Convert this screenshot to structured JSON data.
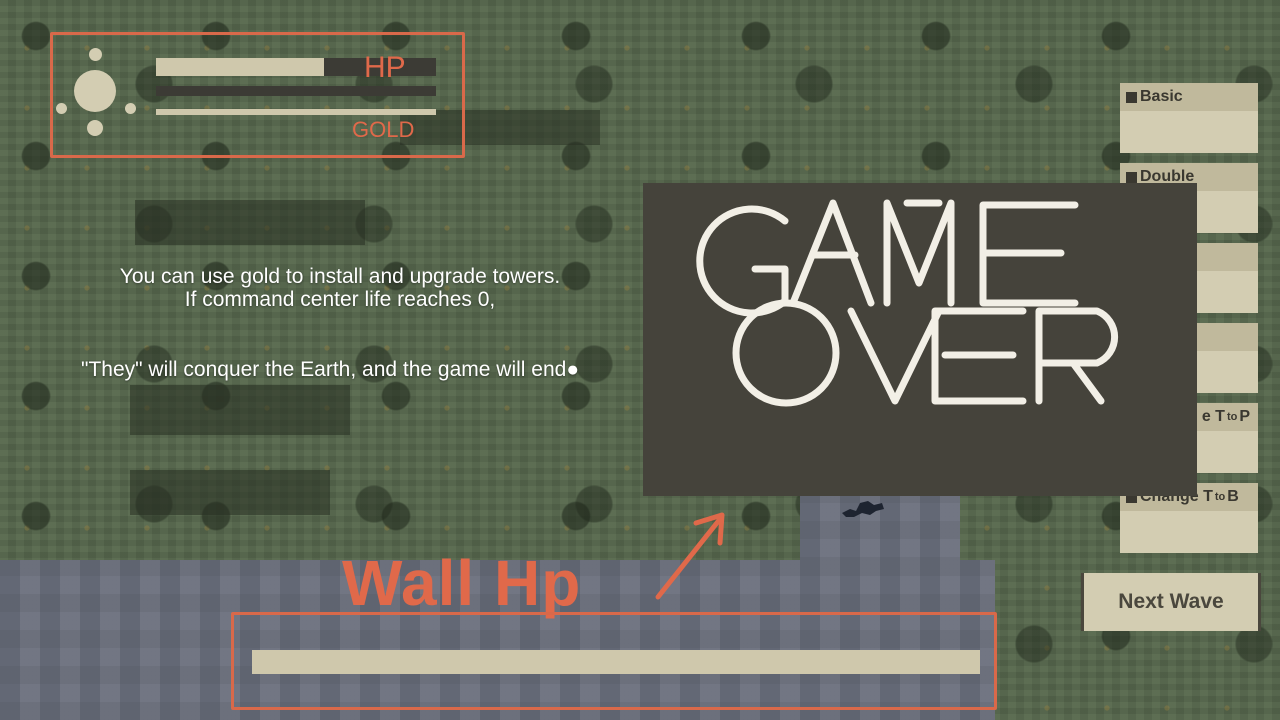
{
  "hud": {
    "hp_label": "HP",
    "gold_label": "GOLD",
    "hp_fraction": 0.6,
    "gold_fraction": 1.0
  },
  "tutorial": {
    "line1": "You can use gold to install and upgrade towers.",
    "line2": "If command center life reaches 0,",
    "line3": "\"They\" will conquer the Earth, and the game will end●"
  },
  "towers": [
    {
      "pre": "",
      "label": "Basic",
      "to": "",
      "post": ""
    },
    {
      "pre": "",
      "label": "Double",
      "to": "",
      "post": ""
    },
    {
      "pre": "",
      "label": "",
      "to": "",
      "post": ""
    },
    {
      "pre": "",
      "label": "",
      "to": "",
      "post": ""
    },
    {
      "pre": "",
      "label": "e T",
      "to": "to",
      "post": "P"
    },
    {
      "pre": "",
      "label": "Change T",
      "to": "to",
      "post": "B"
    }
  ],
  "next_wave_label": "Next Wave",
  "game_over": {
    "line1": "GAME",
    "line2": "OVER"
  },
  "wall": {
    "label": "Wall Hp",
    "hp_fraction": 1.0
  },
  "colors": {
    "annotation": "#e0694a",
    "panel": "#d3cdb2",
    "overlay": "#45433b"
  }
}
